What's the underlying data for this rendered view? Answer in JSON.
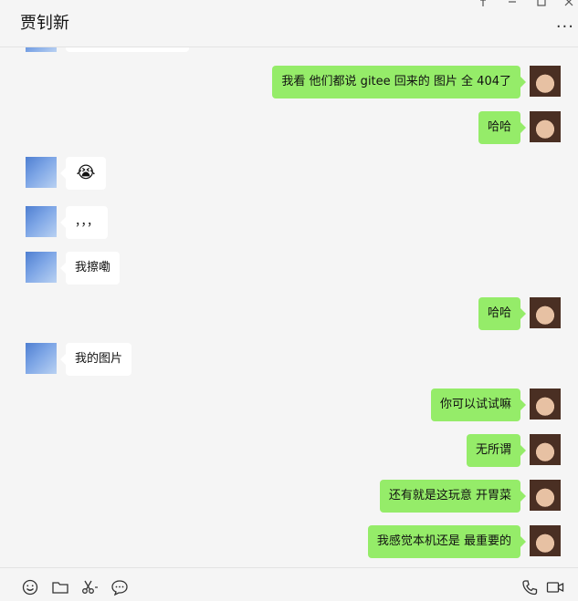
{
  "header": {
    "title": "贾钊新",
    "more_label": "...",
    "window_controls": [
      "pin-icon",
      "minimize-icon",
      "maximize-icon",
      "close-icon"
    ]
  },
  "messages": [
    {
      "side": "right",
      "text": "我看 他们都说 gitee 回来的 图片 全  404了"
    },
    {
      "side": "right",
      "text": "哈哈"
    },
    {
      "side": "left",
      "text": "😭"
    },
    {
      "side": "left",
      "text": "，，，"
    },
    {
      "side": "left",
      "text": "我擦嘞"
    },
    {
      "side": "right",
      "text": "哈哈"
    },
    {
      "side": "left",
      "text": "我的图片"
    },
    {
      "side": "right",
      "text": "你可以试试嘛"
    },
    {
      "side": "right",
      "text": "无所谓"
    },
    {
      "side": "right",
      "text": "还有就是这玩意 开胃菜"
    },
    {
      "side": "right",
      "text": "我感觉本机还是 最重要的"
    }
  ],
  "toolbar": {
    "icons": [
      "emoji-icon",
      "folder-icon",
      "scissors-icon",
      "chat-history-icon",
      "phone-icon",
      "video-icon"
    ]
  },
  "colors": {
    "bubble_self": "#95ec69",
    "bubble_other": "#ffffff",
    "background": "#f5f5f5"
  }
}
